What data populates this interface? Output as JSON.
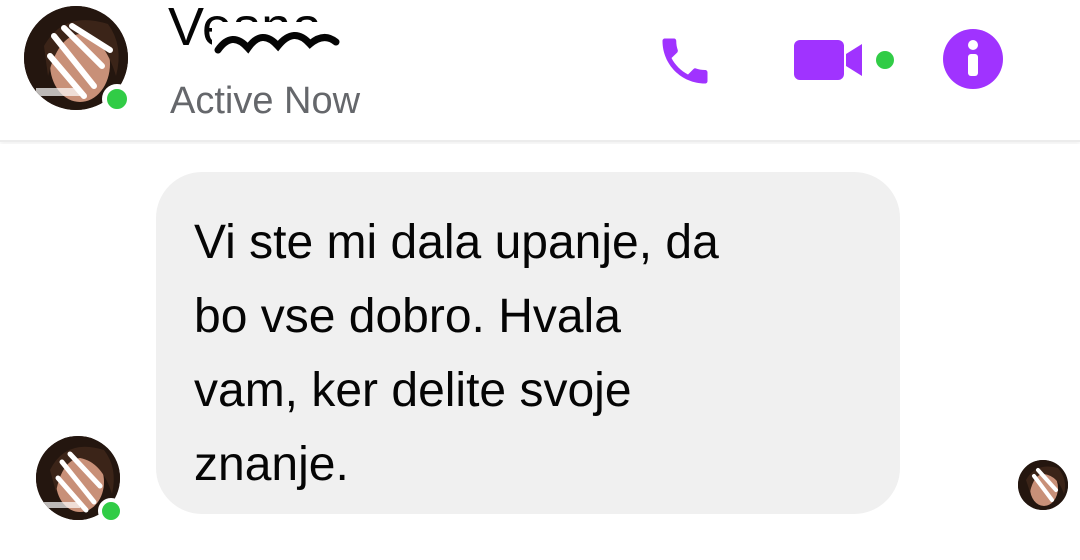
{
  "header": {
    "contact_name": "Vesna",
    "status": "Active Now",
    "icons": {
      "call": "phone-icon",
      "video": "video-camera-icon",
      "info": "info-icon"
    },
    "accent_color": "#a033ff",
    "presence_color": "#31cc46"
  },
  "thread": {
    "messages": [
      {
        "from": "contact",
        "text": "Vi ste mi dala upanje, da\nbo vse dobro. Hvala\nvam, ker delite svoje\nznanje."
      }
    ],
    "bubble_color": "#f0f0f0"
  }
}
